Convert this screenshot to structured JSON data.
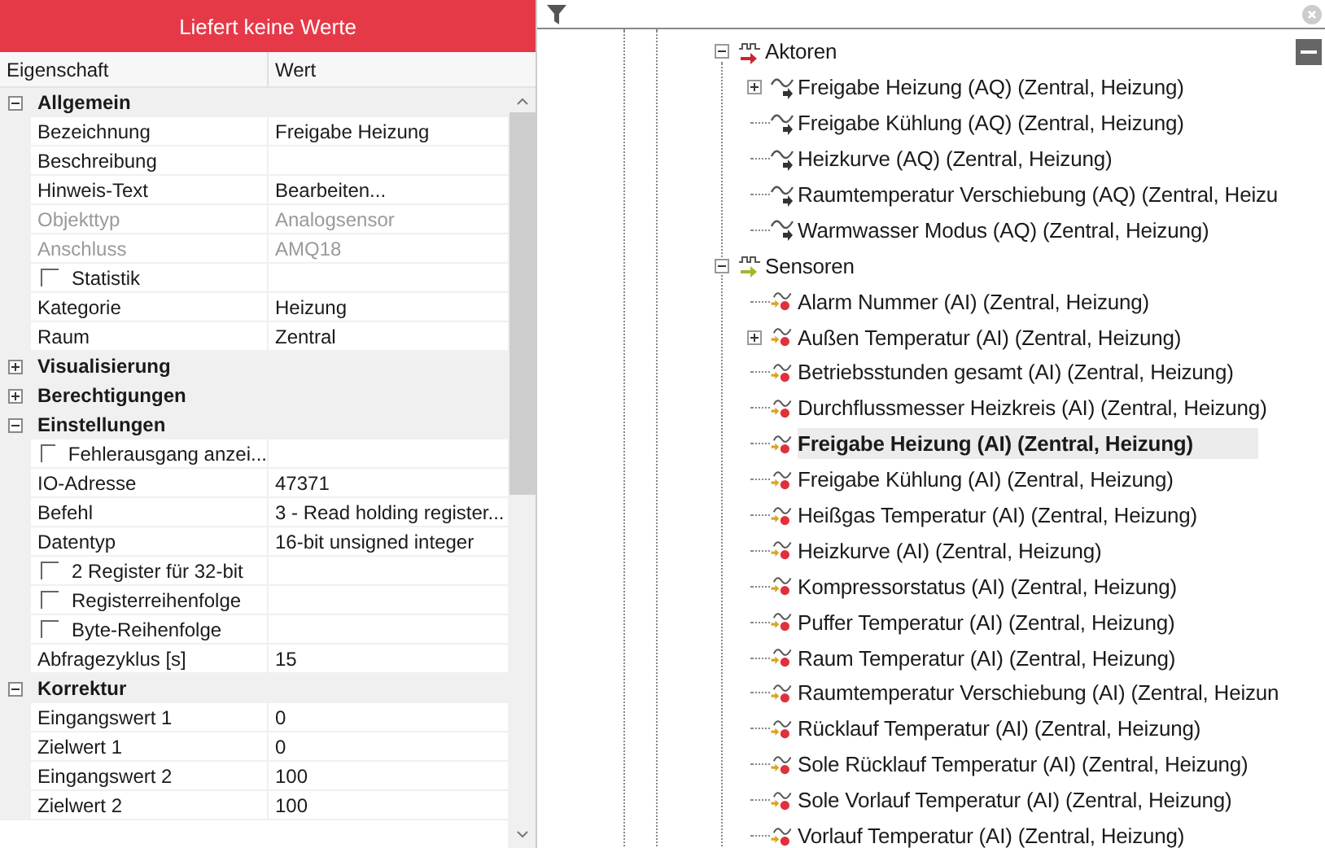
{
  "status_banner": "Liefert keine Werte",
  "properties": {
    "columns": [
      "Eigenschaft",
      "Wert"
    ],
    "categories": [
      {
        "name": "Allgemein",
        "expanded": true,
        "rows": [
          {
            "kind": "text",
            "name": "Bezeichnung",
            "value": "Freigabe Heizung",
            "disabled": false
          },
          {
            "kind": "text",
            "name": "Beschreibung",
            "disabled": false
          },
          {
            "kind": "text",
            "name": "Hinweis-Text",
            "value": "Bearbeiten...",
            "disabled": false
          },
          {
            "kind": "text",
            "name": "Objekttyp",
            "value": "Analogsensor",
            "disabled": true
          },
          {
            "kind": "text",
            "name": "Anschluss",
            "value": "AMQ18",
            "disabled": true
          },
          {
            "kind": "checkbox",
            "name": "Statistik",
            "checked": false
          },
          {
            "kind": "text",
            "name": "Kategorie",
            "value": "Heizung",
            "disabled": false
          },
          {
            "kind": "text",
            "name": "Raum",
            "value": "Zentral",
            "disabled": false
          }
        ]
      },
      {
        "name": "Visualisierung",
        "expanded": false
      },
      {
        "name": "Berechtigungen",
        "expanded": false
      },
      {
        "name": "Einstellungen",
        "expanded": true,
        "rows": [
          {
            "kind": "checkbox",
            "name": "Fehlerausgang anzei...",
            "checked": false
          },
          {
            "kind": "text",
            "name": "IO-Adresse",
            "value": "47371",
            "disabled": false
          },
          {
            "kind": "text",
            "name": "Befehl",
            "value": "3 - Read holding register...",
            "disabled": false
          },
          {
            "kind": "text",
            "name": "Datentyp",
            "value": "16-bit unsigned integer",
            "disabled": false
          },
          {
            "kind": "checkbox",
            "name": "2 Register für 32-bit",
            "checked": false
          },
          {
            "kind": "checkbox",
            "name": "Registerreihenfolge",
            "checked": false
          },
          {
            "kind": "checkbox",
            "name": "Byte-Reihenfolge",
            "checked": false
          },
          {
            "kind": "text",
            "name": "Abfragezyklus [s]",
            "value": "15",
            "disabled": false
          }
        ]
      },
      {
        "name": "Korrektur",
        "expanded": true,
        "rows": [
          {
            "kind": "text",
            "name": "Eingangswert 1",
            "value": "0",
            "disabled": false
          },
          {
            "kind": "text",
            "name": "Zielwert 1",
            "value": "0",
            "disabled": false
          },
          {
            "kind": "text",
            "name": "Eingangswert 2",
            "value": "100",
            "disabled": false
          },
          {
            "kind": "text",
            "name": "Zielwert 2",
            "value": "100",
            "disabled": false
          }
        ]
      }
    ]
  },
  "tree": [
    {
      "kind": "actuator-group",
      "label": "Aktoren",
      "expanded": true,
      "selected": false,
      "children": [
        {
          "kind": "actuator",
          "label": "Freigabe Heizung (AQ) (Zentral, Heizung)",
          "expanded": false,
          "selected": false
        },
        {
          "kind": "actuator",
          "label": "Freigabe Kühlung (AQ) (Zentral, Heizung)",
          "selected": false
        },
        {
          "kind": "actuator",
          "label": "Heizkurve (AQ) (Zentral, Heizung)",
          "selected": false
        },
        {
          "kind": "actuator",
          "label": "Raumtemperatur Verschiebung (AQ) (Zentral, Heizu",
          "selected": false
        },
        {
          "kind": "actuator",
          "label": "Warmwasser Modus (AQ) (Zentral, Heizung)",
          "selected": false
        }
      ]
    },
    {
      "kind": "sensor-group",
      "label": "Sensoren",
      "expanded": true,
      "selected": false,
      "children": [
        {
          "kind": "sensor",
          "label": "Alarm Nummer (AI) (Zentral, Heizung)",
          "selected": false
        },
        {
          "kind": "sensor",
          "label": "Außen Temperatur (AI) (Zentral, Heizung)",
          "expanded": false,
          "selected": false
        },
        {
          "kind": "sensor",
          "label": "Betriebsstunden gesamt (AI) (Zentral, Heizung)",
          "selected": false
        },
        {
          "kind": "sensor",
          "label": "Durchflussmesser Heizkreis (AI) (Zentral, Heizung)",
          "selected": false
        },
        {
          "kind": "sensor",
          "label": "Freigabe Heizung (AI) (Zentral, Heizung)",
          "selected": true
        },
        {
          "kind": "sensor",
          "label": "Freigabe Kühlung (AI) (Zentral, Heizung)",
          "selected": false
        },
        {
          "kind": "sensor",
          "label": "Heißgas Temperatur (AI) (Zentral, Heizung)",
          "selected": false
        },
        {
          "kind": "sensor",
          "label": "Heizkurve (AI) (Zentral, Heizung)",
          "selected": false
        },
        {
          "kind": "sensor",
          "label": "Kompressorstatus (AI) (Zentral, Heizung)",
          "selected": false
        },
        {
          "kind": "sensor",
          "label": "Puffer Temperatur (AI) (Zentral, Heizung)",
          "selected": false
        },
        {
          "kind": "sensor",
          "label": "Raum Temperatur (AI) (Zentral, Heizung)",
          "selected": false
        },
        {
          "kind": "sensor",
          "label": "Raumtemperatur Verschiebung (AI) (Zentral, Heizun",
          "selected": false
        },
        {
          "kind": "sensor",
          "label": "Rücklauf Temperatur (AI) (Zentral, Heizung)",
          "selected": false
        },
        {
          "kind": "sensor",
          "label": "Sole Rücklauf Temperatur (AI) (Zentral, Heizung)",
          "selected": false
        },
        {
          "kind": "sensor",
          "label": "Sole Vorlauf Temperatur (AI) (Zentral, Heizung)",
          "selected": false
        },
        {
          "kind": "sensor",
          "label": "Vorlauf Temperatur (AI) (Zentral, Heizung)",
          "selected": false
        }
      ]
    }
  ]
}
